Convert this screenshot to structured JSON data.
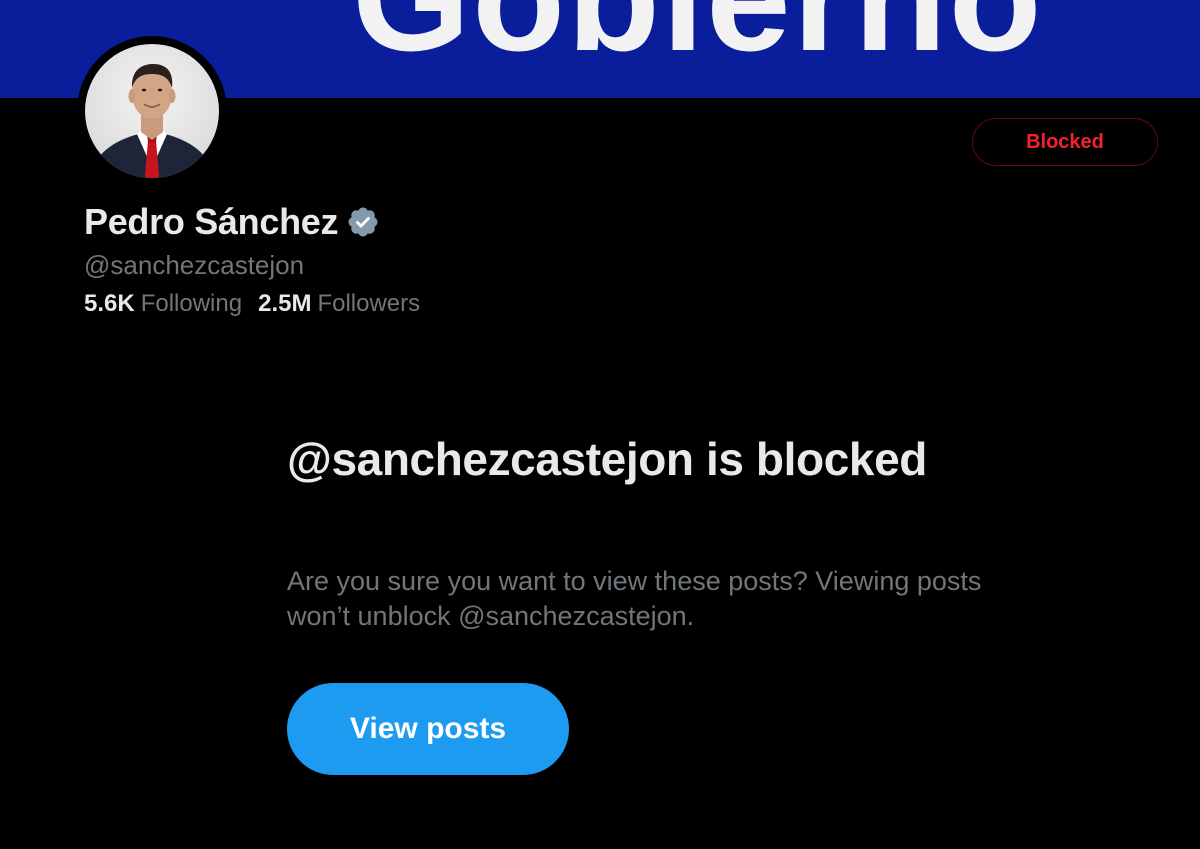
{
  "banner": {
    "text": "Gobierno",
    "color": "#0a1e9c"
  },
  "profile": {
    "display_name": "Pedro Sánchez",
    "verified_icon": "verified-badge-icon",
    "verified_color": "#829aab",
    "handle": "@sanchezcastejon",
    "following_count": "5.6K",
    "following_label": "Following",
    "followers_count": "2.5M",
    "followers_label": "Followers"
  },
  "actions": {
    "blocked_label": "Blocked",
    "blocked_color": "#f4212e"
  },
  "blocked_notice": {
    "title": "@sanchezcastejon is blocked",
    "description": "Are you sure you want to view these posts? Viewing posts won’t unblock @sanchezcastejon.",
    "button_label": "View posts",
    "button_color": "#1d9bf0"
  }
}
